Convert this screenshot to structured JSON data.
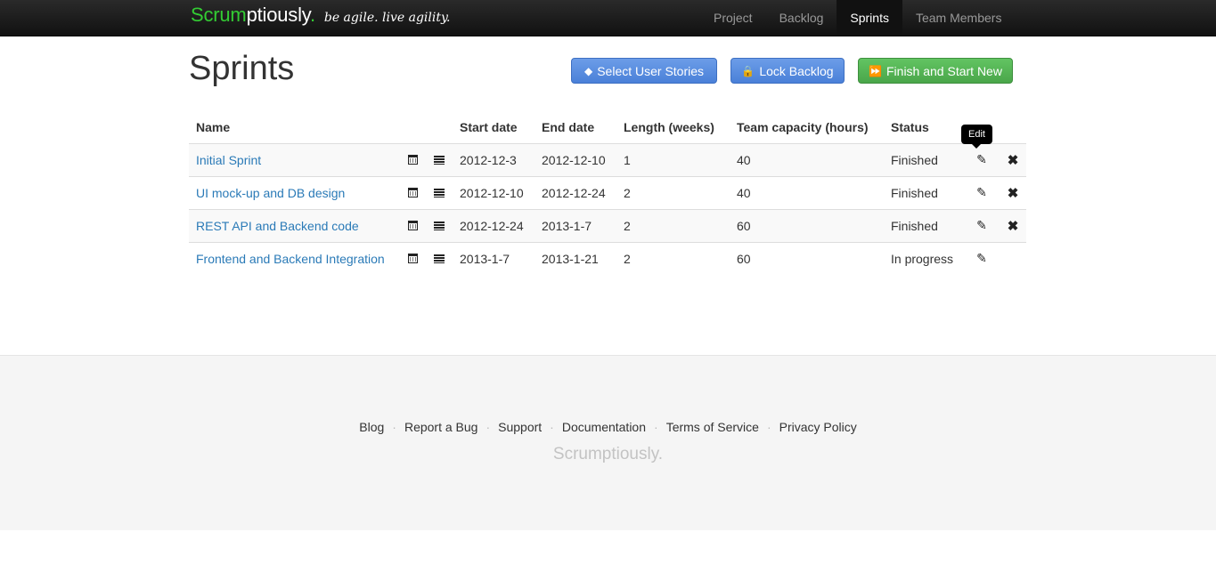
{
  "brand": {
    "part1": "Scrum",
    "part2": "ptiously",
    "dot": ".",
    "tagline": "be agile. live agility."
  },
  "nav": [
    {
      "label": "Project"
    },
    {
      "label": "Backlog"
    },
    {
      "label": "Sprints"
    },
    {
      "label": "Team Members"
    }
  ],
  "page": {
    "title": "Sprints",
    "buttons": {
      "select_stories": "Select User Stories",
      "lock_backlog": "Lock Backlog",
      "finish_start": "Finish and Start New"
    }
  },
  "table": {
    "headers": [
      "Name",
      "Start date",
      "End date",
      "Length (weeks)",
      "Team capacity (hours)",
      "Status"
    ],
    "rows": [
      {
        "name": "Initial Sprint",
        "start": "2012-12-3",
        "end": "2012-12-10",
        "length": "1",
        "capacity": "40",
        "status": "Finished"
      },
      {
        "name": "UI mock-up and DB design",
        "start": "2012-12-10",
        "end": "2012-12-24",
        "length": "2",
        "capacity": "40",
        "status": "Finished"
      },
      {
        "name": "REST API and Backend code",
        "start": "2012-12-24",
        "end": "2013-1-7",
        "length": "2",
        "capacity": "60",
        "status": "Finished"
      },
      {
        "name": "Frontend and Backend Integration",
        "start": "2013-1-7",
        "end": "2013-1-21",
        "length": "2",
        "capacity": "60",
        "status": "In progress"
      }
    ]
  },
  "tooltip": {
    "text": "Edit"
  },
  "footer": {
    "links": [
      "Blog",
      "Report a Bug",
      "Support",
      "Documentation",
      "Terms of Service",
      "Privacy Policy"
    ],
    "brand": "Scrumptiously."
  },
  "colors": {
    "brand_green": "#33cc33",
    "link": "#2a7ab7",
    "btn_blue": "#5b8fe0",
    "btn_green": "#5bb75b"
  },
  "icons": {
    "select_stories": "tag-icon",
    "lock_backlog": "lock-icon",
    "finish_start": "fast-forward-icon",
    "row_calendar": "calendar-icon",
    "row_list": "list-icon",
    "row_edit": "pencil-icon",
    "row_delete": "close-icon"
  }
}
